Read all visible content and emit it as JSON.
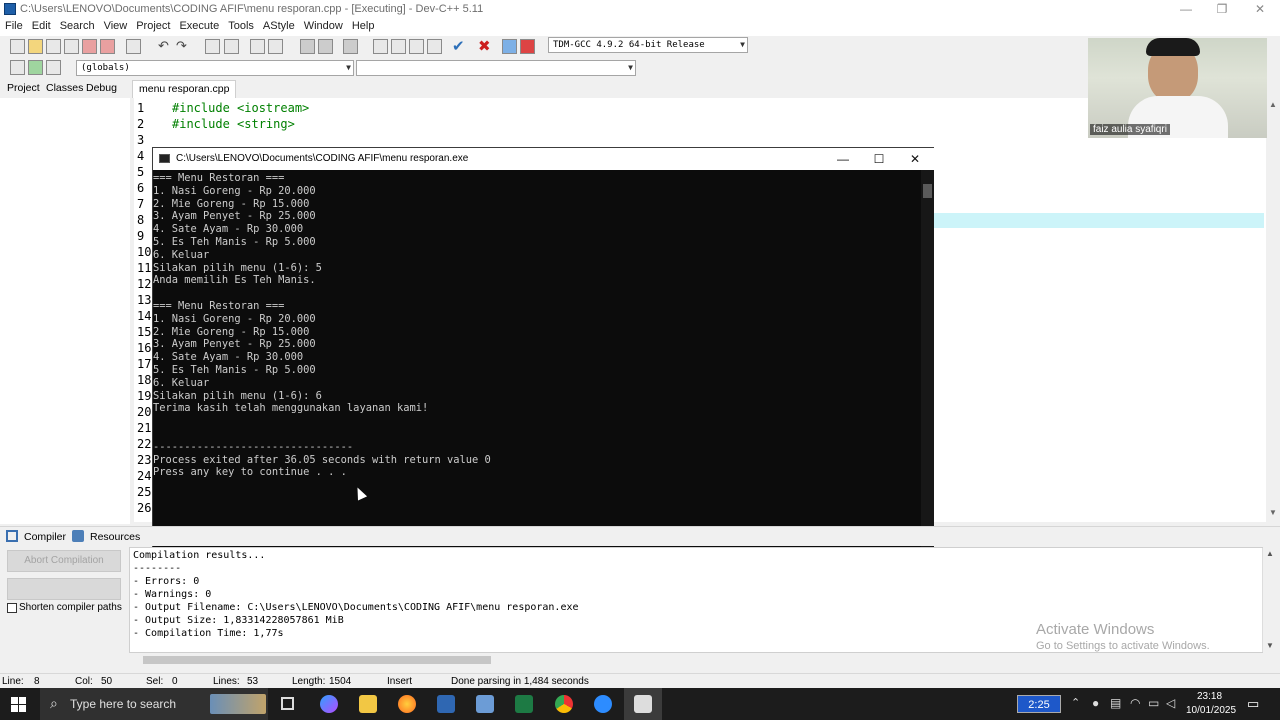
{
  "window": {
    "title": "C:\\Users\\LENOVO\\Documents\\CODING AFIF\\menu resporan.cpp - [Executing] - Dev-C++ 5.11",
    "controls": [
      "—",
      "❐",
      "✕"
    ]
  },
  "menu": [
    "File",
    "Edit",
    "Search",
    "View",
    "Project",
    "Execute",
    "Tools",
    "AStyle",
    "Window",
    "Help"
  ],
  "toolbar": {
    "compiler_select": "TDM-GCC 4.9.2 64-bit Release",
    "scope_select": "(globals)",
    "function_select": ""
  },
  "left_tabs": [
    "Project",
    "Classes",
    "Debug"
  ],
  "editor": {
    "tab": "menu resporan.cpp",
    "lines": [
      "1",
      "2",
      "3",
      "4",
      "5",
      "6",
      "7",
      "8",
      "9",
      "10",
      "11",
      "12",
      "13",
      "14",
      "15",
      "16",
      "17",
      "18",
      "19",
      "20",
      "21",
      "22",
      "23",
      "24",
      "25",
      "26"
    ],
    "code": [
      "#include <iostream>",
      "#include <string>"
    ]
  },
  "console": {
    "title": "C:\\Users\\LENOVO\\Documents\\CODING AFIF\\menu resporan.exe",
    "output": "=== Menu Restoran ===\n1. Nasi Goreng - Rp 20.000\n2. Mie Goreng - Rp 15.000\n3. Ayam Penyet - Rp 25.000\n4. Sate Ayam - Rp 30.000\n5. Es Teh Manis - Rp 5.000\n6. Keluar\nSilakan pilih menu (1-6): 5\nAnda memilih Es Teh Manis.\n\n=== Menu Restoran ===\n1. Nasi Goreng - Rp 20.000\n2. Mie Goreng - Rp 15.000\n3. Ayam Penyet - Rp 25.000\n4. Sate Ayam - Rp 30.000\n5. Es Teh Manis - Rp 5.000\n6. Keluar\nSilakan pilih menu (1-6): 6\nTerima kasih telah menggunakan layanan kami!\n\n\n--------------------------------\nProcess exited after 36.05 seconds with return value 0\nPress any key to continue . . ."
  },
  "bottom_tabs": [
    "Compiler",
    "Resources"
  ],
  "compiler": {
    "abort_button": "Abort Compilation",
    "shorten_label": "Shorten compiler paths",
    "results": "Compilation results...\n--------\n- Errors: 0\n- Warnings: 0\n- Output Filename: C:\\Users\\LENOVO\\Documents\\CODING AFIF\\menu resporan.exe\n- Output Size: 1,83314228057861 MiB\n- Compilation Time: 1,77s"
  },
  "watermark": {
    "title": "Activate Windows",
    "subtitle": "Go to Settings to activate Windows."
  },
  "status": {
    "line_label": "Line:",
    "line": "8",
    "col_label": "Col:",
    "col": "50",
    "sel_label": "Sel:",
    "sel": "0",
    "lines_label": "Lines:",
    "lines": "53",
    "length_label": "Length:",
    "length": "1504",
    "mode": "Insert",
    "message": "Done parsing in 1,484 seconds"
  },
  "taskbar": {
    "search_placeholder": "Type here to search",
    "zoom_timer": "2:25",
    "time": "23:18",
    "date": "10/01/2025"
  },
  "webcam": {
    "name": "faiz aulia syafiqri"
  }
}
